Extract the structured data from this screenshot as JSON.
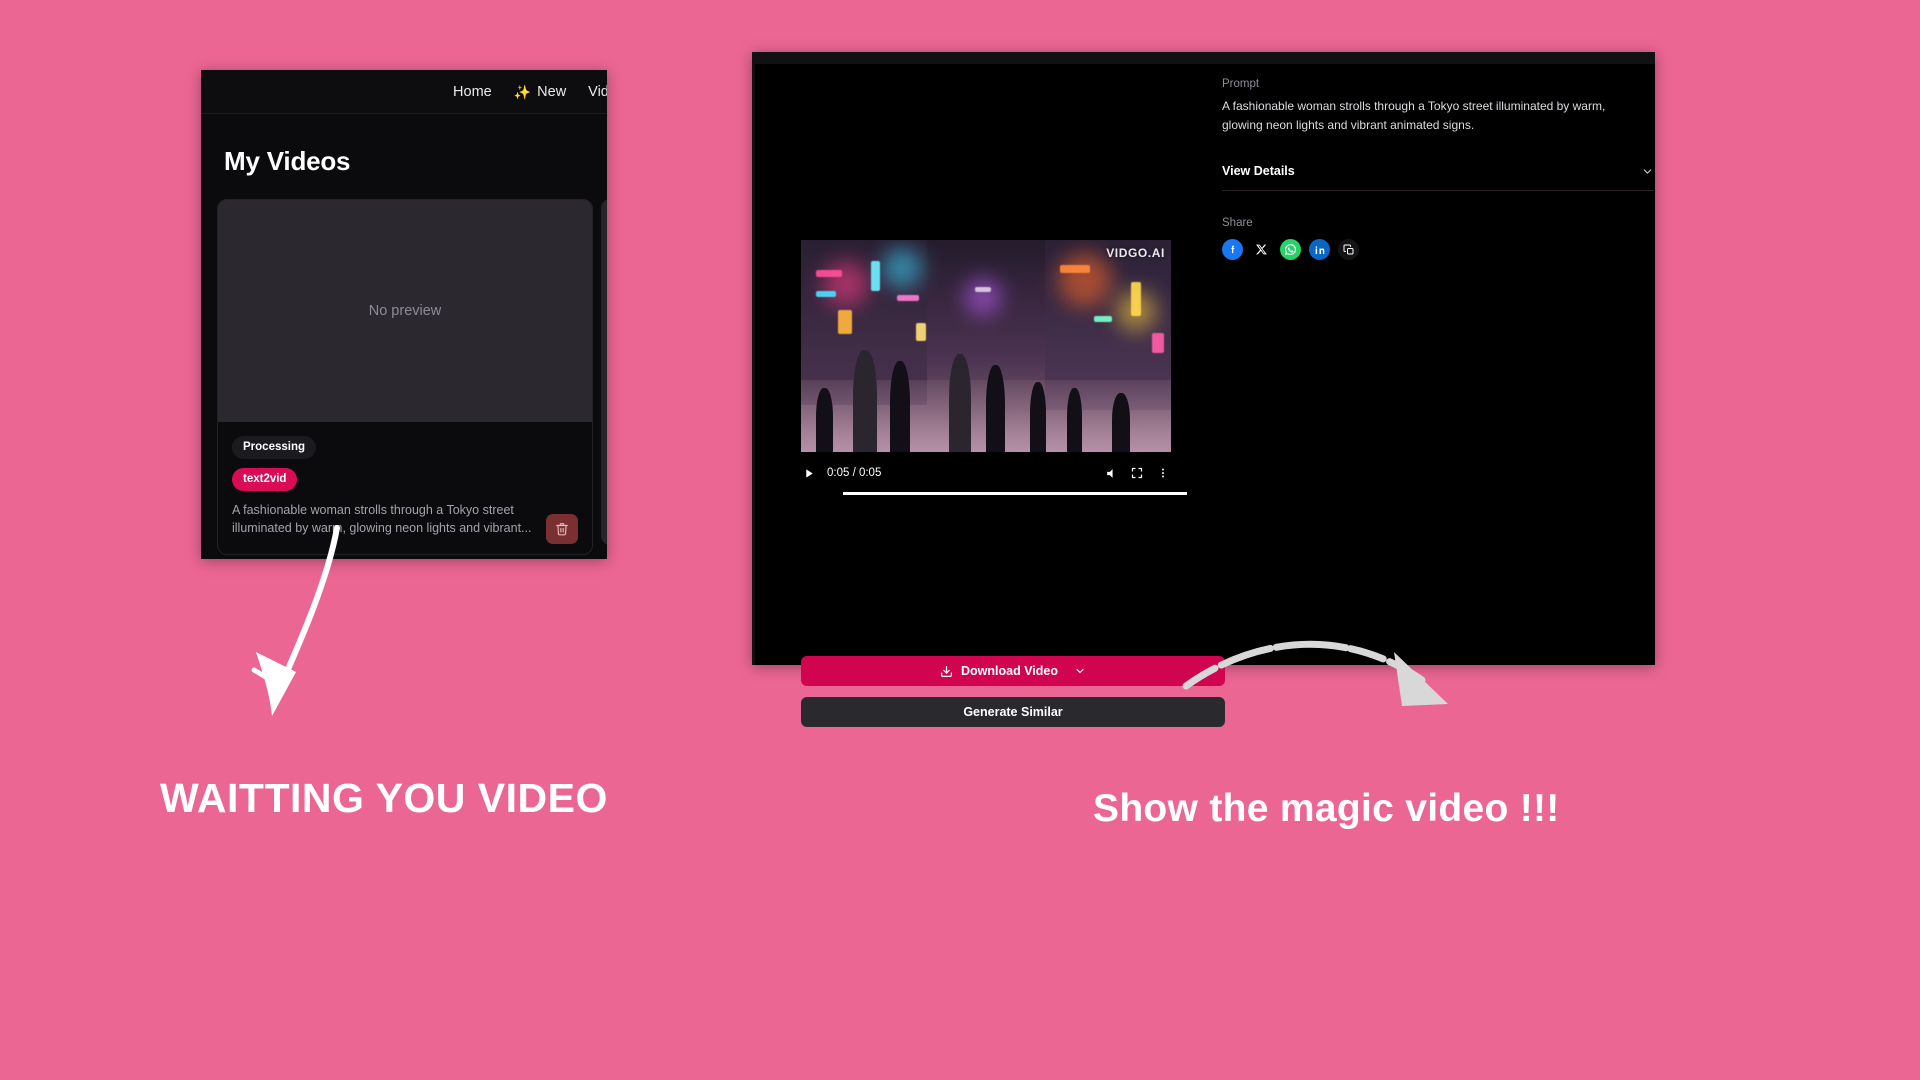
{
  "background_color": "#ec6694",
  "left_window": {
    "nav": {
      "items": [
        {
          "label": "Home",
          "icon": null
        },
        {
          "label": "New",
          "icon": "sparkles-icon"
        },
        {
          "label": "Video",
          "icon": null
        }
      ]
    },
    "page_title": "My Videos",
    "card": {
      "preview_placeholder": "No preview",
      "status_badge": "Processing",
      "type_badge": "text2vid",
      "prompt": "A fashionable woman strolls through a Tokyo street illuminated by warm, glowing neon lights and vibrant...",
      "delete_icon": "trash-icon",
      "delete_color": "#7a3030",
      "type_badge_color": "#d90c55"
    }
  },
  "right_window": {
    "player": {
      "watermark": "VIDGO.AI",
      "time_display": "0:05 / 0:05",
      "play_icon": "play-icon",
      "mute_icon": "volume-icon",
      "fullscreen_icon": "fullscreen-icon",
      "more_icon": "more-vertical-icon"
    },
    "actions": {
      "download_label": "Download Video",
      "download_icon": "download-icon",
      "download_chevron": "chevron-down-icon",
      "download_color": "#d1054f",
      "generate_label": "Generate Similar"
    },
    "meta": {
      "prompt_label": "Prompt",
      "prompt_text": "A fashionable woman strolls through a Tokyo street illuminated by warm, glowing neon lights and vibrant animated signs.",
      "view_details_label": "View Details",
      "view_details_chevron": "chevron-down-icon",
      "share_label": "Share",
      "share_buttons": [
        {
          "name": "facebook",
          "glyph": "f",
          "color": "#1877f2"
        },
        {
          "name": "x-twitter",
          "glyph": "✕",
          "color": "#000000"
        },
        {
          "name": "whatsapp",
          "glyph": "✆",
          "color": "#25d366"
        },
        {
          "name": "linkedin",
          "glyph": "in",
          "color": "#0a66c2"
        },
        {
          "name": "copy-link",
          "glyph": "⧉",
          "color": "#141416"
        }
      ]
    }
  },
  "annotations": {
    "caption_left": "WAITTING YOU VIDEO",
    "caption_right": "Show the magic video !!!",
    "arrow_left": "arrow-down-curved",
    "arrow_right": "arrow-down-right-curved"
  }
}
